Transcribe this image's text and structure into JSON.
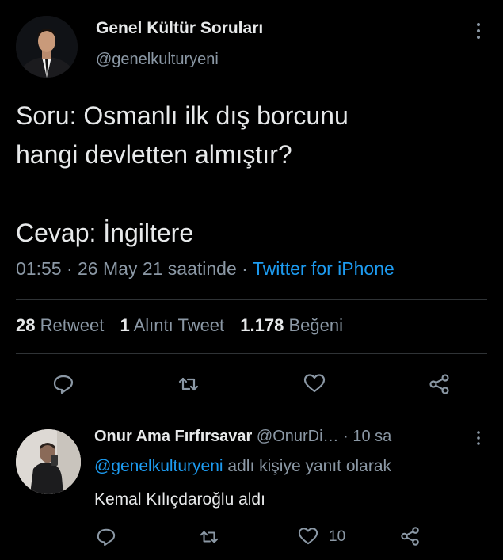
{
  "tweet": {
    "author_name": "Genel Kültür Soruları",
    "author_handle": "@genelkulturyeni",
    "text_lines": [
      "Soru: Osmanlı ilk dış borcunu",
      "hangi devletten almıştır?",
      "Cevap: İngiltere"
    ],
    "time": "01:55",
    "date_text": "26 May 21 saatinde",
    "separator": "·",
    "source": "Twitter for iPhone",
    "stats": {
      "retweets": "28",
      "retweets_label": "Retweet",
      "quotes": "1",
      "quotes_label": "Alıntı Tweet",
      "likes": "1.178",
      "likes_label": "Beğeni"
    },
    "actions": [
      "reply-icon",
      "retweet-icon",
      "like-icon",
      "share-icon"
    ]
  },
  "reply": {
    "author_name": "Onur Ama Fırfırsavar",
    "author_handle": "@OnurDi…",
    "time_ago": "10 sa",
    "separator": "·",
    "reply_prefix": "@genelkulturyeni",
    "reply_suffix": "adlı kişiye yanıt olarak",
    "text": "Kemal Kılıçdaroğlu aldı",
    "like_count": "10"
  },
  "colors": {
    "background": "#000000",
    "text": "#e7e9ea",
    "muted": "#8b98a5",
    "accent": "#1d9bf0",
    "divider": "#2f3336"
  }
}
